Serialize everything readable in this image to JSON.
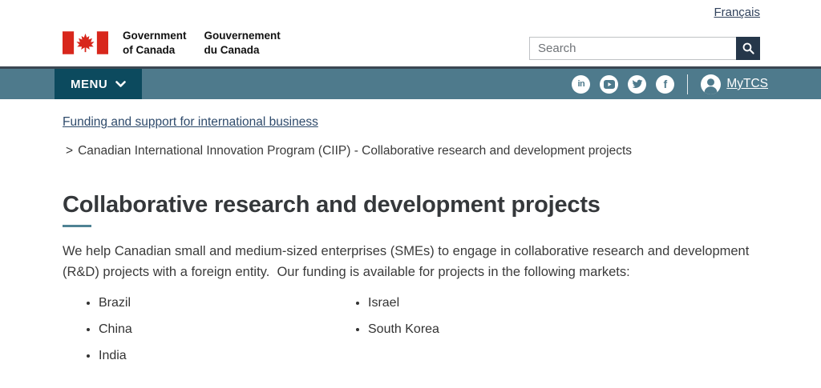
{
  "topbar": {
    "language_link": "Français"
  },
  "header": {
    "logo": {
      "en_line1": "Government",
      "en_line2": "of Canada",
      "fr_line1": "Gouvernement",
      "fr_line2": "du Canada"
    },
    "search": {
      "placeholder": "Search"
    }
  },
  "menubar": {
    "menu_label": "MENU",
    "social_icons": [
      "linkedin",
      "youtube",
      "twitter",
      "facebook"
    ],
    "account_label": "MyTCS"
  },
  "breadcrumb": {
    "link": "Funding and support for international business",
    "separator": ">",
    "current": "Canadian International Innovation Program (CIIP) - Collaborative research and development projects"
  },
  "main": {
    "title": "Collaborative research and development projects",
    "intro": "We help Canadian small and medium-sized enterprises (SMEs) to engage in collaborative research and development (R&D) projects with a foreign entity.  Our funding is available for projects in the following markets:",
    "markets_col1": [
      "Brazil",
      "China",
      "India"
    ],
    "markets_col2": [
      "Israel",
      "South Korea"
    ]
  },
  "colors": {
    "menubar_teal": "#4e7a8c",
    "menu_button_teal": "#0c4a5e",
    "search_button_navy": "#26374a",
    "flag_red": "#d8271c",
    "heading_underline_teal": "#4e8294",
    "link_navy": "#2e4a6b",
    "menubar_top_border": "#3b4752"
  }
}
